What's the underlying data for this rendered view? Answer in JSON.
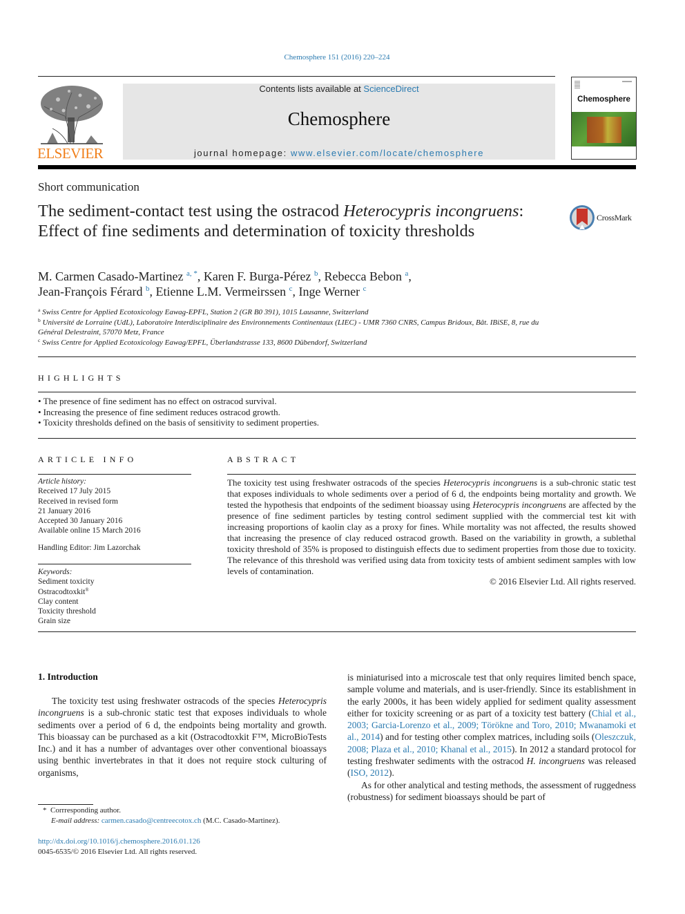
{
  "header": {
    "citation": "Chemosphere 151 (2016) 220–224",
    "contents_prefix": "Contents lists available at ",
    "contents_link": "ScienceDirect",
    "journal_name": "Chemosphere",
    "homepage_prefix": "journal homepage: ",
    "homepage_link": "www.elsevier.com/locate/chemosphere",
    "publisher_logo_text": "ELSEVIER",
    "cover_title": "Chemosphere",
    "crossmark_label": "CrossMark",
    "colors": {
      "link": "#2a7ab0",
      "elsevier_orange": "#f07f1a",
      "banner_gray": "#e6e6e6"
    }
  },
  "article": {
    "type": "Short communication",
    "title_part1": "The sediment-contact test using the ostracod ",
    "title_italic1": "Heterocypris incongruens",
    "title_part2": ": Effect of fine sediments and determination of toxicity thresholds",
    "authors": [
      {
        "name": "M. Carmen Casado-Martinez",
        "sup": "a, *",
        "sep": ", "
      },
      {
        "name": "Karen F. Burga-Pérez",
        "sup": "b",
        "sep": ", "
      },
      {
        "name": "Rebecca Bebon",
        "sup": "a",
        "sep": ","
      },
      {
        "name": "Jean-François Férard",
        "sup": "b",
        "sep": ", "
      },
      {
        "name": "Etienne L.M. Vermeirssen",
        "sup": "c",
        "sep": ", "
      },
      {
        "name": "Inge Werner",
        "sup": "c",
        "sep": ""
      }
    ],
    "affiliations": [
      {
        "key": "a",
        "text": "Swiss Centre for Applied Ecotoxicology Eawag-EPFL, Station 2 (GR B0 391), 1015 Lausanne, Switzerland"
      },
      {
        "key": "b",
        "text": "Université de Lorraine (UdL), Laboratoire Interdisciplinaire des Environnements Continentaux (LIEC) - UMR 7360 CNRS, Campus Bridoux, Bât. IBiSE, 8, rue du Général Delestraint, 57070 Metz, France"
      },
      {
        "key": "c",
        "text": "Swiss Centre for Applied Ecotoxicology Eawag/EPFL, Überlandstrasse 133, 8600 Dübendorf, Switzerland"
      }
    ]
  },
  "highlights": {
    "heading": "HIGHLIGHTS",
    "items": [
      "The presence of fine sediment has no effect on ostracod survival.",
      "Increasing the presence of fine sediment reduces ostracod growth.",
      "Toxicity thresholds defined on the basis of sensitivity to sediment properties."
    ]
  },
  "article_info": {
    "heading": "ARTICLE INFO",
    "history_label": "Article history:",
    "history": [
      "Received 17 July 2015",
      "Received in revised form",
      "21 January 2016",
      "Accepted 30 January 2016",
      "Available online 15 March 2016"
    ],
    "handling_editor": "Handling Editor: Jim Lazorchak",
    "keywords_label": "Keywords:",
    "keywords": [
      "Sediment toxicity",
      "Ostracodtoxkit",
      "Clay content",
      "Toxicity threshold",
      "Grain size"
    ],
    "keyword_registered_mark": "®"
  },
  "abstract": {
    "heading": "ABSTRACT",
    "seg1": "The toxicity test using freshwater ostracods of the species ",
    "it1": "Heterocypris incongruens",
    "seg2": " is a sub-chronic static test that exposes individuals to whole sediments over a period of 6 d, the endpoints being mortality and growth. We tested the hypothesis that endpoints of the sediment bioassay using ",
    "it2": "Heterocypris incongruens",
    "seg3": " are affected by the presence of fine sediment particles by testing control sediment supplied with the commercial test kit with increasing proportions of kaolin clay as a proxy for fines. While mortality was not affected, the results showed that increasing the presence of clay reduced ostracod growth. Based on the variability in growth, a sublethal toxicity threshold of 35% is proposed to distinguish effects due to sediment properties from those due to toxicity. The relevance of this threshold was verified using data from toxicity tests of ambient sediment samples with low levels of contamination.",
    "copyright": "© 2016 Elsevier Ltd. All rights reserved."
  },
  "introduction": {
    "heading": "1.  Introduction",
    "left_seg1": "The toxicity test using freshwater ostracods of the species ",
    "left_it1": "Heterocypris incongruens",
    "left_seg2": " is a sub-chronic static test that exposes individuals to whole sediments over a period of 6 d, the endpoints being mortality and growth. This bioassay can be purchased as a kit (Ostracodtoxkit F™, MicroBioTests Inc.) and it has a number of advantages over other conventional bioassays using benthic invertebrates in that it does not require stock culturing of organisms,",
    "right_seg1": "is miniaturised into a microscale test that only requires limited bench space, sample volume and materials, and is user-friendly. Since its establishment in the early 2000s, it has been widely applied for sediment quality assessment either for toxicity screening or as part of a toxicity test battery (",
    "ref1": "Chial et al., 2003; Garcia-Lorenzo et al., 2009; Törökne and Toro, 2010; Mwanamoki et al., 2014",
    "right_seg2": ") and for testing other complex matrices, including soils (",
    "ref2": "Oleszczuk, 2008; Plaza et al., 2010; Khanal et al., 2015",
    "right_seg3": "). In 2012 a standard protocol for testing freshwater sediments with the ostracod ",
    "right_it1": "H. incongruens",
    "right_seg4": " was released (",
    "ref3": "ISO, 2012",
    "right_seg5": ").",
    "right_p2": "As for other analytical and testing methods, the assessment of ruggedness (robustness) for sediment bioassays should be part of"
  },
  "footnotes": {
    "corresponding_marker": "*",
    "corresponding_text": "Corrresponding author.",
    "email_label": "E-mail address:",
    "email": "carmen.casado@centreecotox.ch",
    "email_suffix": "(M.C. Casado-Martinez).",
    "doi": "http://dx.doi.org/10.1016/j.chemosphere.2016.01.126",
    "issn_line": "0045-6535/© 2016 Elsevier Ltd. All rights reserved."
  }
}
